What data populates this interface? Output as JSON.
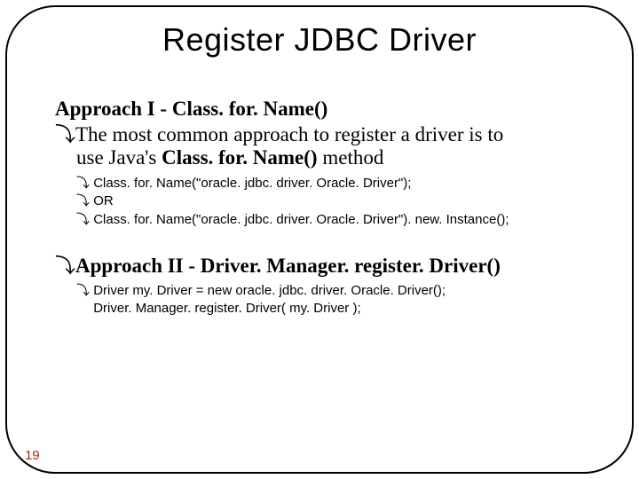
{
  "title": "Register JDBC Driver",
  "approach1": {
    "heading_prefix": "Approach I - ",
    "heading_method": "Class. for. Name()",
    "line1_part1": "The most common approach to register a driver is to",
    "line1_part2_prefix": "use Java's ",
    "line1_part2_bold": "Class. for. Name()",
    "line1_part2_suffix": " method",
    "sub": [
      "Class. for. Name(\"oracle. jdbc. driver. Oracle. Driver\");",
      "OR",
      "Class. for. Name(\"oracle. jdbc. driver. Oracle. Driver\"). new. Instance();"
    ]
  },
  "approach2": {
    "heading": "Approach II - Driver. Manager. register. Driver()",
    "sub_line1": "Driver my. Driver = new oracle. jdbc. driver. Oracle. Driver();",
    "sub_line2": "Driver. Manager. register. Driver( my. Driver );"
  },
  "bullet_glyph": "⤵",
  "page_number": "19"
}
